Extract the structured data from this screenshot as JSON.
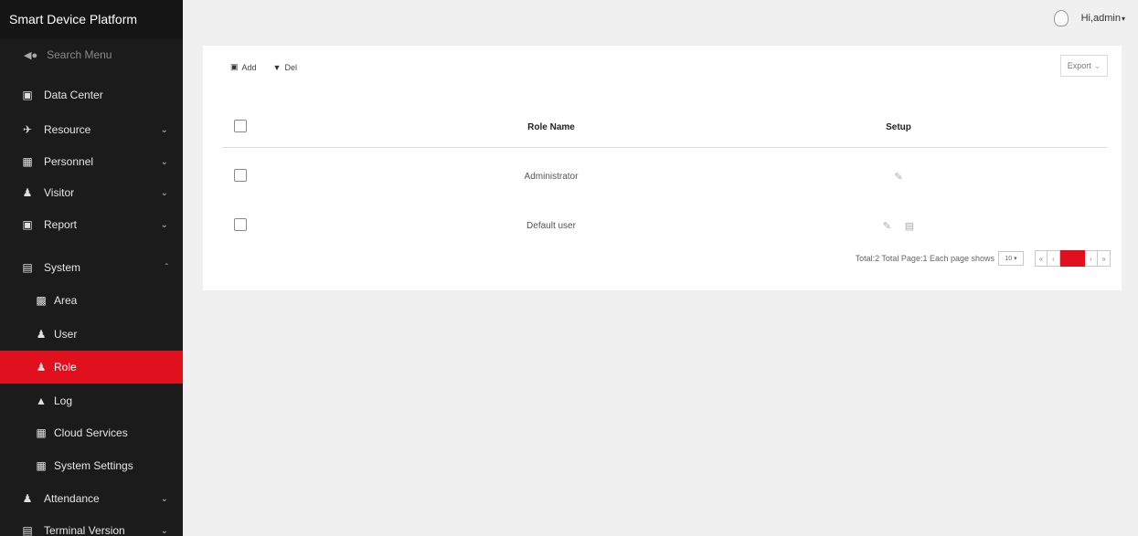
{
  "sidebar": {
    "brand": "Smart Device Platform",
    "search_label": "Search Menu",
    "items": [
      {
        "label": "Data Center",
        "icon": "monitor-icon"
      },
      {
        "label": "Resource",
        "icon": "plane-icon",
        "chevron": "down"
      },
      {
        "label": "Personnel",
        "icon": "people-icon",
        "chevron": "down"
      },
      {
        "label": "Visitor",
        "icon": "person-icon",
        "chevron": "down"
      },
      {
        "label": "Report",
        "icon": "monitor-icon",
        "chevron": "down"
      },
      {
        "label": "System",
        "icon": "drive-icon",
        "chevron": "up"
      },
      {
        "label": "Area",
        "icon": "area-icon"
      },
      {
        "label": "User",
        "icon": "person-icon"
      },
      {
        "label": "Role",
        "icon": "person-icon",
        "active": true
      },
      {
        "label": "Log",
        "icon": "log-icon"
      },
      {
        "label": "Cloud Services",
        "icon": "calendar-icon"
      },
      {
        "label": "System Settings",
        "icon": "calendar-icon"
      },
      {
        "label": "Attendance",
        "icon": "person-icon",
        "chevron": "down"
      },
      {
        "label": "Terminal Version",
        "icon": "drive-icon",
        "chevron": "down"
      }
    ]
  },
  "header": {
    "user_label": "Hi,admin"
  },
  "toolbar": {
    "add_label": "Add",
    "del_label": "Del",
    "export_label": "Export"
  },
  "table": {
    "columns": [
      "Role Name",
      "Setup"
    ],
    "rows": [
      {
        "role_name": "Administrator"
      },
      {
        "role_name": "Default user"
      }
    ]
  },
  "pagination": {
    "summary": "Total:2 Total Page:1 Each page shows",
    "page_size": "10",
    "current_page": "1"
  },
  "colors": {
    "accent": "#e0101e",
    "sidebar_bg": "#1b1b1b",
    "content_bg": "#f0f0f0"
  }
}
